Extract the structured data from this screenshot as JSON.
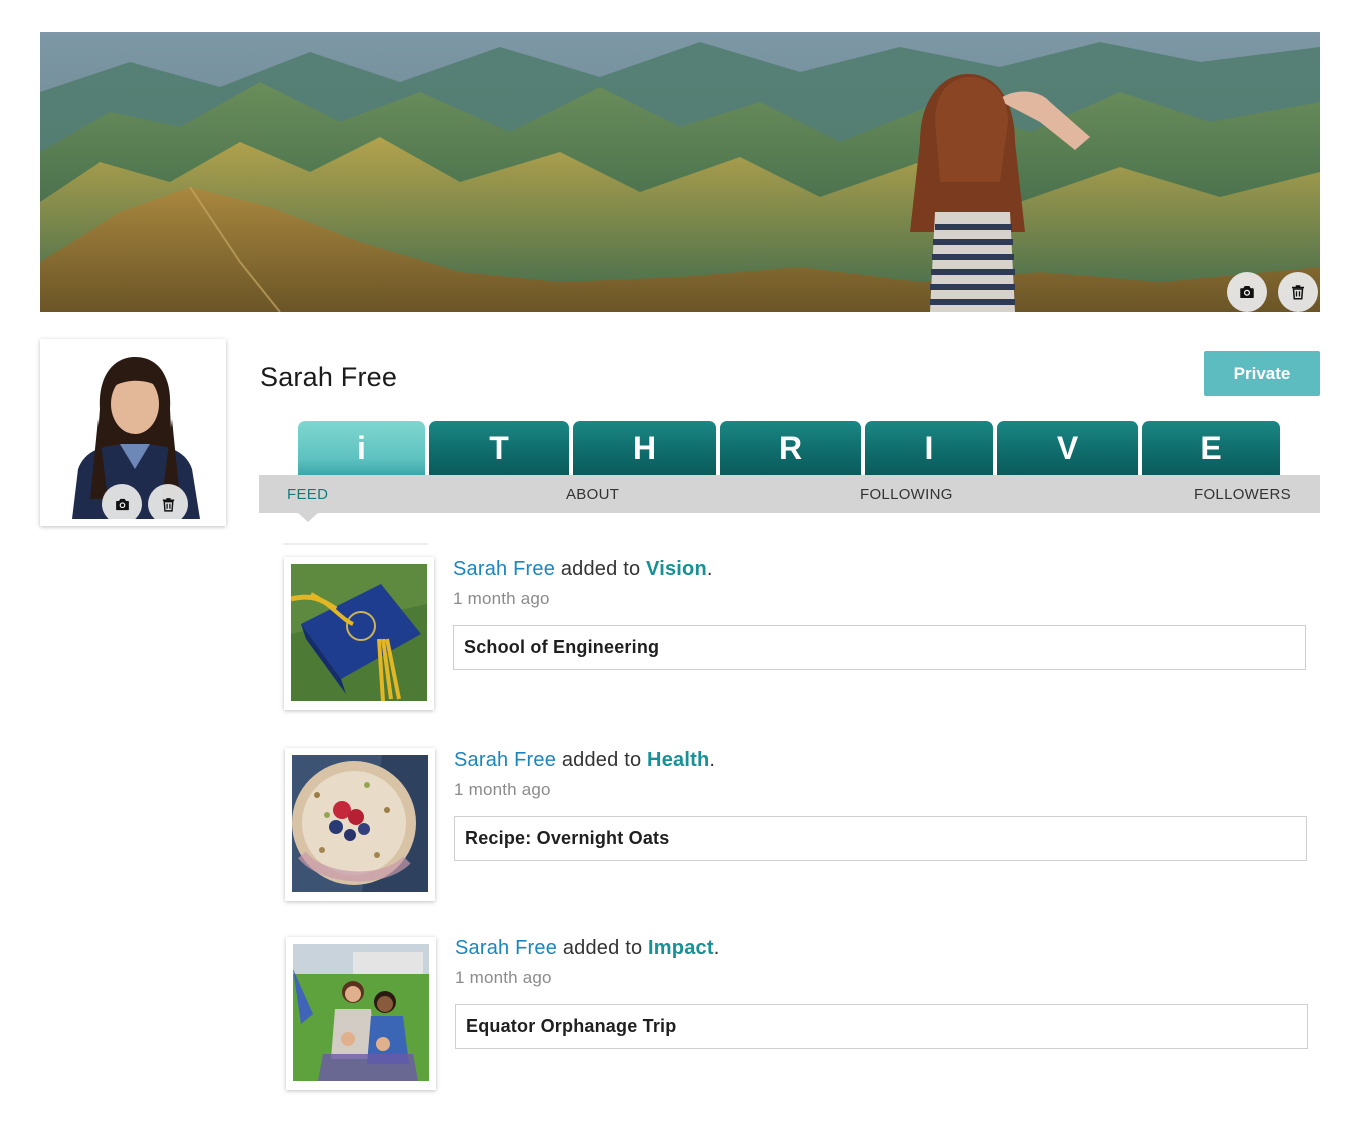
{
  "profile": {
    "name": "Sarah Free",
    "privacy_label": "Private"
  },
  "icons": {
    "camera": "camera-icon",
    "trash": "trash-icon"
  },
  "colors": {
    "brand_teal": "#0f6d6c",
    "active_tab": "#5ec2c0",
    "private_button": "#5cbcbf",
    "link_blue": "#1a86bf",
    "category_teal": "#179195"
  },
  "thrive_tabs": [
    {
      "letter": "i",
      "active": true
    },
    {
      "letter": "T",
      "active": false
    },
    {
      "letter": "H",
      "active": false
    },
    {
      "letter": "R",
      "active": false
    },
    {
      "letter": "I",
      "active": false
    },
    {
      "letter": "V",
      "active": false
    },
    {
      "letter": "E",
      "active": false
    }
  ],
  "subnav": {
    "items": [
      "FEED",
      "ABOUT",
      "FOLLOWING",
      "FOLLOWERS"
    ],
    "active": "FEED"
  },
  "feed": {
    "action_text": "added to",
    "period": ".",
    "items": [
      {
        "user": "Sarah Free",
        "category": "Vision",
        "time": "1 month ago",
        "title": "School of Engineering",
        "thumbnail": "graduation-cap"
      },
      {
        "user": "Sarah Free",
        "category": "Health",
        "time": "1 month ago",
        "title": "Recipe: Overnight Oats",
        "thumbnail": "oats-bowl"
      },
      {
        "user": "Sarah Free",
        "category": "Impact",
        "time": "1 month ago",
        "title": "Equator Orphanage Trip",
        "thumbnail": "group-photo"
      }
    ]
  }
}
